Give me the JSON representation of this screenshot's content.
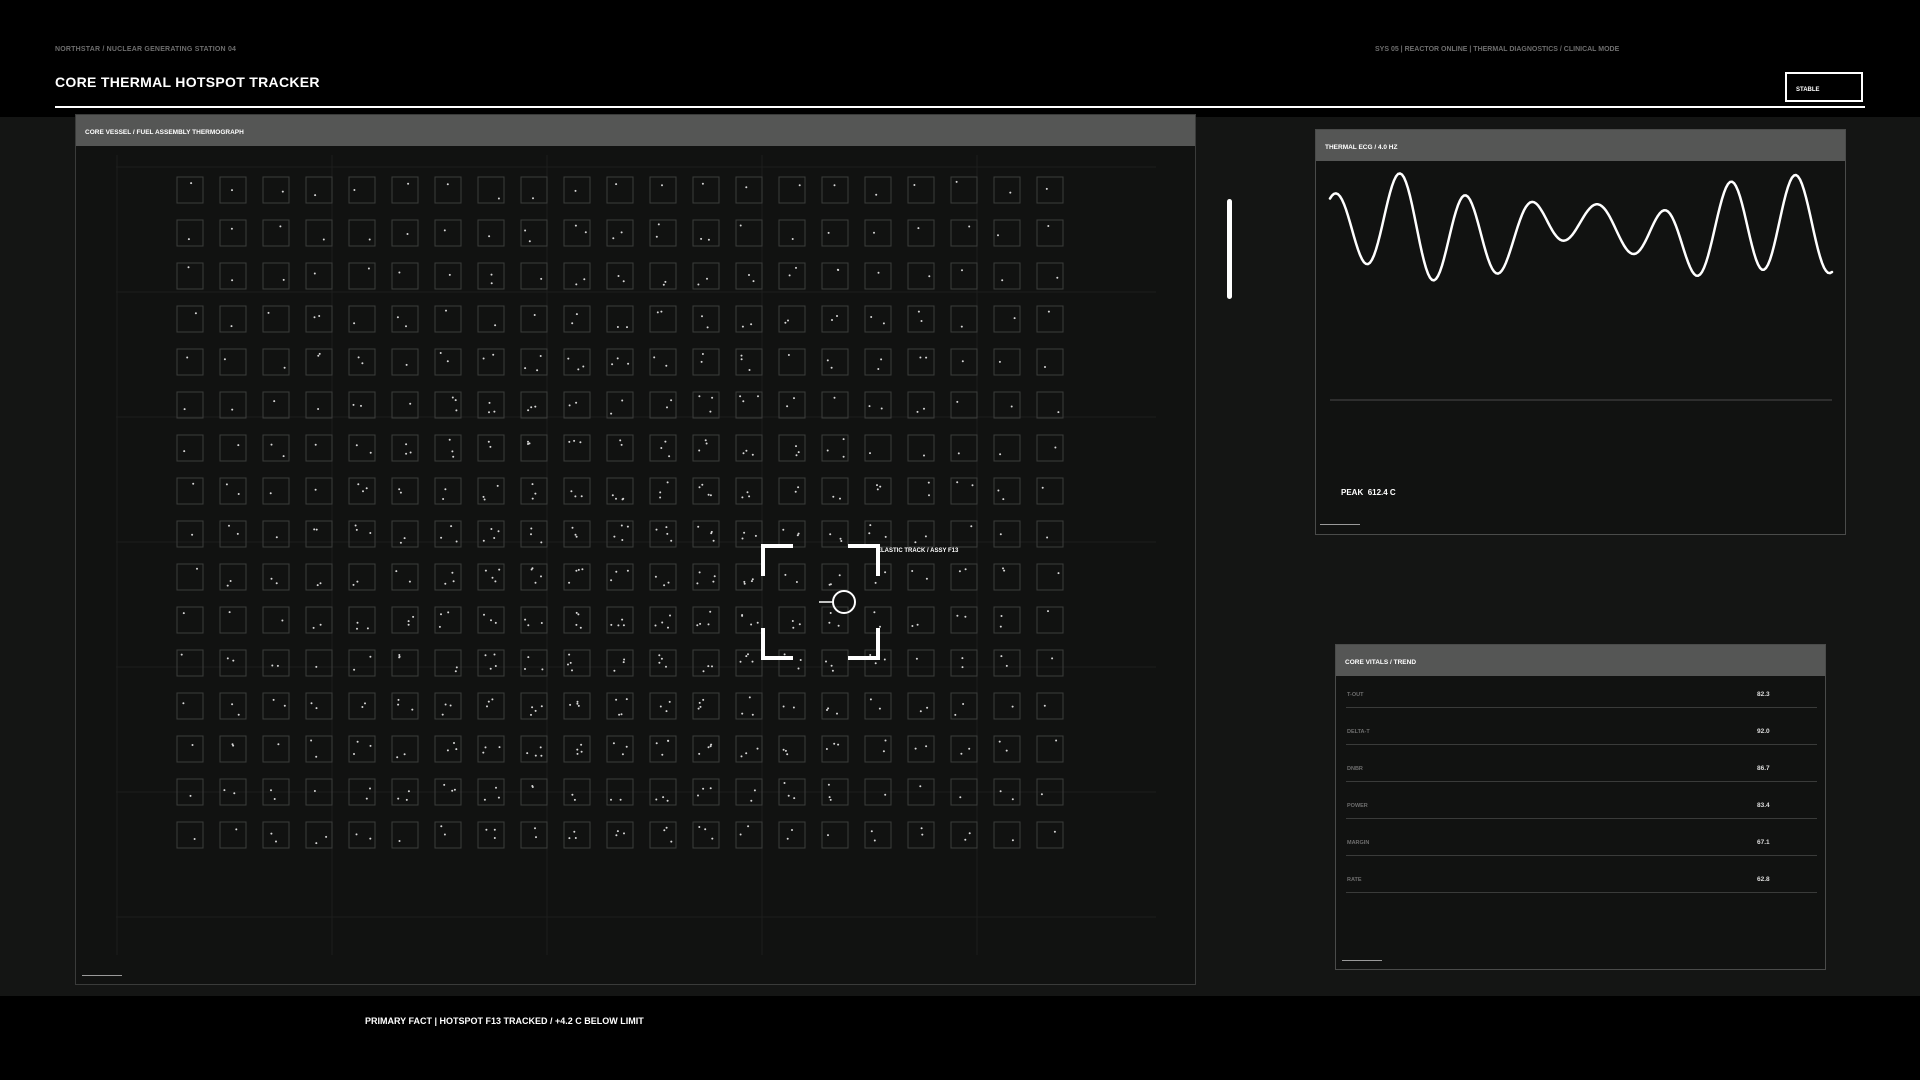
{
  "header": {
    "breadcrumb": "NORTHSTAR / NUCLEAR GENERATING STATION 04",
    "system_status": "SYS 05 | REACTOR ONLINE | THERMAL DIAGNOSTICS / CLINICAL MODE",
    "title": "CORE THERMAL HOTSPOT TRACKER",
    "status_badge": "STABLE"
  },
  "thermograph": {
    "title": "CORE VESSEL / FUEL ASSEMBLY THERMOGRAPH",
    "grid_rows": 16,
    "grid_cols": 21,
    "tracker_label": "ELASTIC TRACK / ASSY F13"
  },
  "ecg": {
    "title": "THERMAL ECG / 4.0 HZ",
    "peak_label": "PEAK",
    "peak_value": "612.4 C"
  },
  "vitals": {
    "title": "CORE VITALS / TREND",
    "rows": [
      {
        "label": "T-OUT",
        "value": "82.3"
      },
      {
        "label": "DELTA-T",
        "value": "92.0"
      },
      {
        "label": "DNBR",
        "value": "86.7"
      },
      {
        "label": "POWER",
        "value": "83.4"
      },
      {
        "label": "MARGIN",
        "value": "67.1"
      },
      {
        "label": "RATE",
        "value": "62.8"
      }
    ]
  },
  "footer": {
    "primary_fact": "PRIMARY FACT | HOTSPOT F13 TRACKED / +4.2 C BELOW LIMIT"
  },
  "colors": {
    "background": "#000000",
    "workspace": "#141514",
    "panel_header": "#555655",
    "accent": "#ffffff",
    "muted_text": "#6e6e6e"
  }
}
